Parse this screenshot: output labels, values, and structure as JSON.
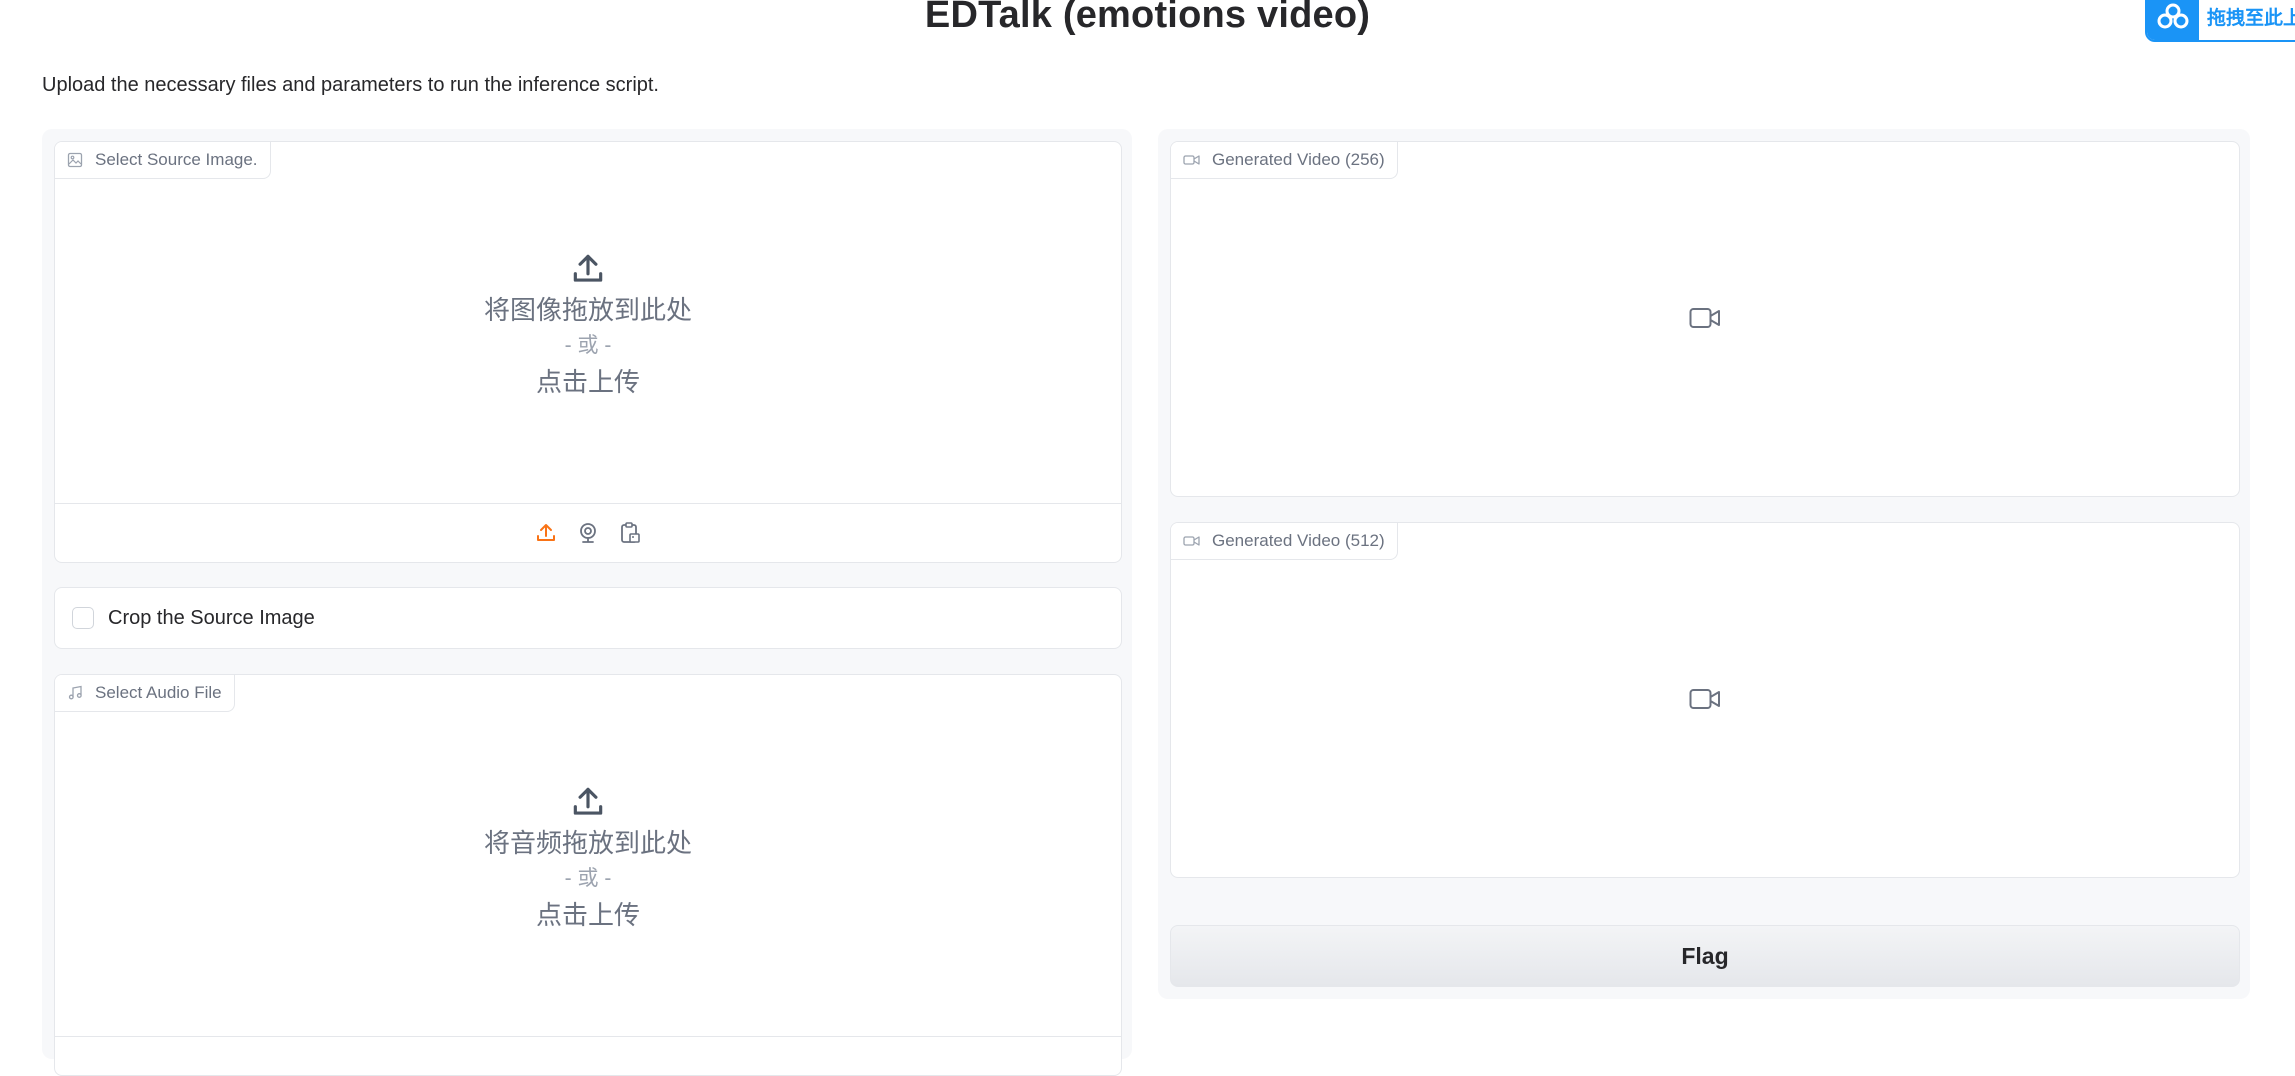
{
  "header": {
    "title": "EDTalk (emotions video)",
    "description": "Upload the necessary files and parameters to run the inference script."
  },
  "baidu_widget": {
    "label": "拖拽至此上"
  },
  "inputs": {
    "source_image": {
      "label": "Select Source Image.",
      "drop_text": "将图像拖放到此处",
      "or_text": "- 或 -",
      "click_text": "点击上传",
      "toolbar": [
        "upload-icon",
        "webcam-icon",
        "clipboard-icon"
      ]
    },
    "crop": {
      "label": "Crop the Source Image",
      "checked": false
    },
    "audio_file": {
      "label": "Select Audio File",
      "drop_text": "将音频拖放到此处",
      "or_text": "- 或 -",
      "click_text": "点击上传"
    }
  },
  "outputs": {
    "video_256": {
      "label": "Generated Video (256)"
    },
    "video_512": {
      "label": "Generated Video (512)"
    },
    "flag_label": "Flag"
  },
  "colors": {
    "accent": "#f97316",
    "brand_blue": "#1a94f6",
    "muted": "#6b7280"
  }
}
